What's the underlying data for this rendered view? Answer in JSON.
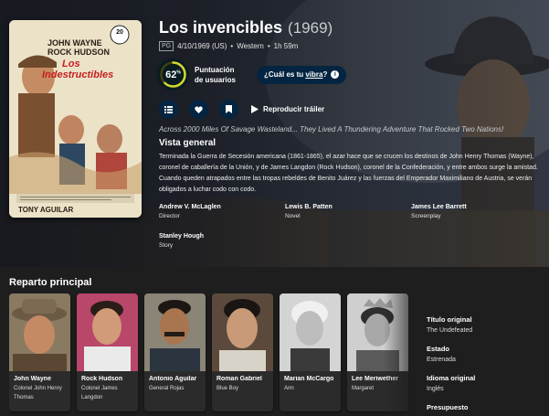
{
  "movie": {
    "title": "Los invencibles",
    "year": "(1969)",
    "certification": "PG",
    "release": "4/10/1969 (US)",
    "genre": "Western",
    "runtime": "1h 59m",
    "score": "62",
    "score_fraction": 0.62,
    "score_label": "Puntuación de usuarios",
    "vibe_prefix": "¿Cuál es tu ",
    "vibe_word": "vibra",
    "vibe_suffix": "?",
    "trailer_label": "Reproducir tráiler",
    "tagline": "Across 2000 Miles Of Savage Wasteland... They Lived A Thundering Adventure That Rocked Two Nations!",
    "overview_heading": "Vista general",
    "overview": "Terminada la Guerra de Secesión americana (1861-1865), el azar hace que se crucen los destinos de John Henry Thomas (Wayne), coronel de caballería de la Unión, y de James Langdon (Rock Hudson), coronel de la Confederación, y entre ambos surge la amistad. Cuando queden atrapados entre las tropas rebeldes de Benito Juárez y las fuerzas del Emperador Maximiliano de Austria, se verán obligados a luchar codo con codo."
  },
  "poster": {
    "stars_top": "JOHN WAYNE",
    "stars_bottom": "ROCK HUDSON",
    "title_line1": "Los",
    "title_line2": "Indestructibles",
    "badge": "20",
    "footer": "TONY AGUILAR"
  },
  "crew": [
    {
      "name": "Andrew V. McLaglen",
      "role": "Director"
    },
    {
      "name": "Lewis B. Patten",
      "role": "Novel"
    },
    {
      "name": "James Lee Barrett",
      "role": "Screenplay"
    },
    {
      "name": "Stanley Hough",
      "role": "Story"
    }
  ],
  "cast_heading": "Reparto principal",
  "cast": [
    {
      "name": "John Wayne",
      "role": "Colonel John Henry Thomas"
    },
    {
      "name": "Rock Hudson",
      "role": "Colonel James Langdon"
    },
    {
      "name": "Antonio Aguilar",
      "role": "General Rojas"
    },
    {
      "name": "Roman Gabriel",
      "role": "Blue Boy"
    },
    {
      "name": "Marian McCargo",
      "role": "Ann"
    },
    {
      "name": "Lee Meriwether",
      "role": "Margaret"
    }
  ],
  "facts": [
    {
      "label": "Título original",
      "value": "The Undefeated"
    },
    {
      "label": "Estado",
      "value": "Estrenada"
    },
    {
      "label": "Idioma original",
      "value": "Inglés"
    },
    {
      "label": "Presupuesto",
      "value": ""
    }
  ],
  "colors": {
    "accent_navy": "#032541",
    "score_ring": "#d2d531",
    "score_track": "#423d0f"
  },
  "icons": [
    "list-icon",
    "heart-icon",
    "bookmark-icon",
    "play-icon",
    "info-icon"
  ]
}
